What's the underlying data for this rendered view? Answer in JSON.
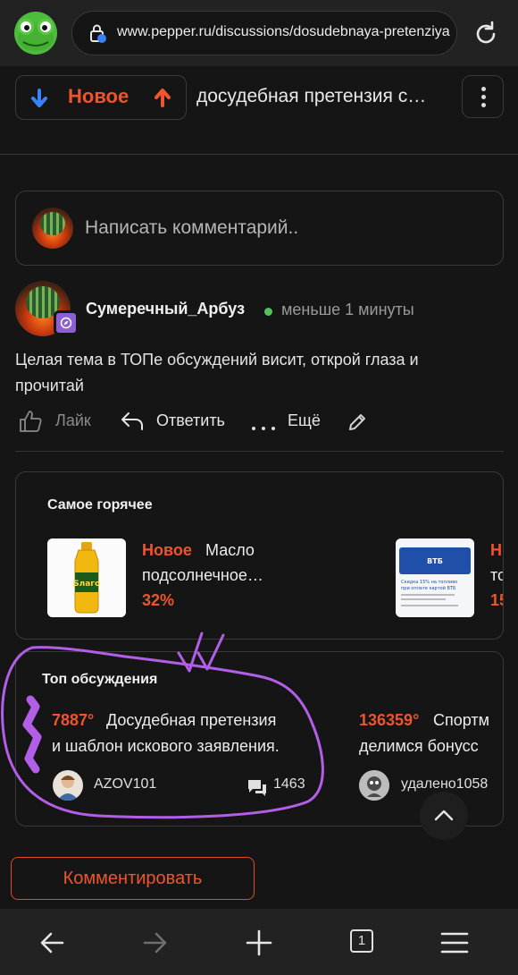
{
  "browser": {
    "url": "www.pepper.ru/discussions/dosudebnaya-pretenziya",
    "tab_count": "1"
  },
  "header": {
    "sort_label": "Новое",
    "thread_title": "досудебная претензия с…"
  },
  "composer": {
    "placeholder": "Написать комментарий.."
  },
  "comment": {
    "author": "Сумеречный_Арбуз",
    "time": "меньше 1 минуты",
    "body": "Целая тема в ТОПе обсуждений висит, открой глаза и прочитай",
    "actions": {
      "like": "Лайк",
      "reply": "Ответить",
      "more": "Ещё"
    }
  },
  "hottest": {
    "title": "Самое горячее",
    "deals": [
      {
        "tag": "Новое",
        "line1": "Масло",
        "line2": "подсолнечное…",
        "percent": "32%",
        "thumb_label": "Благо"
      },
      {
        "tag": "Н",
        "line1": "то",
        "line2": "",
        "percent": "15",
        "thumb_text1": "Скидка 15% на топливо",
        "thumb_text2": "при оплате картой ВТБ",
        "thumb_brand": "ВТБ"
      }
    ]
  },
  "top_discussions": {
    "title": "Топ обсуждения",
    "items": [
      {
        "score": "7887°",
        "line1": "Досудебная претензия",
        "line2": "и шаблон искового заявления.",
        "user": "AZOV101",
        "comments": "1463"
      },
      {
        "score": "136359°",
        "line1": "Спортм",
        "line2": "делимся бонусс",
        "user": "удалено1058",
        "comments": ""
      }
    ]
  },
  "footer": {
    "comment_button": "Комментировать"
  },
  "colors": {
    "accent": "#f0542d",
    "background": "#151515",
    "bar": "#222222",
    "online": "#55c15a",
    "annotation": "#b25ee6"
  }
}
